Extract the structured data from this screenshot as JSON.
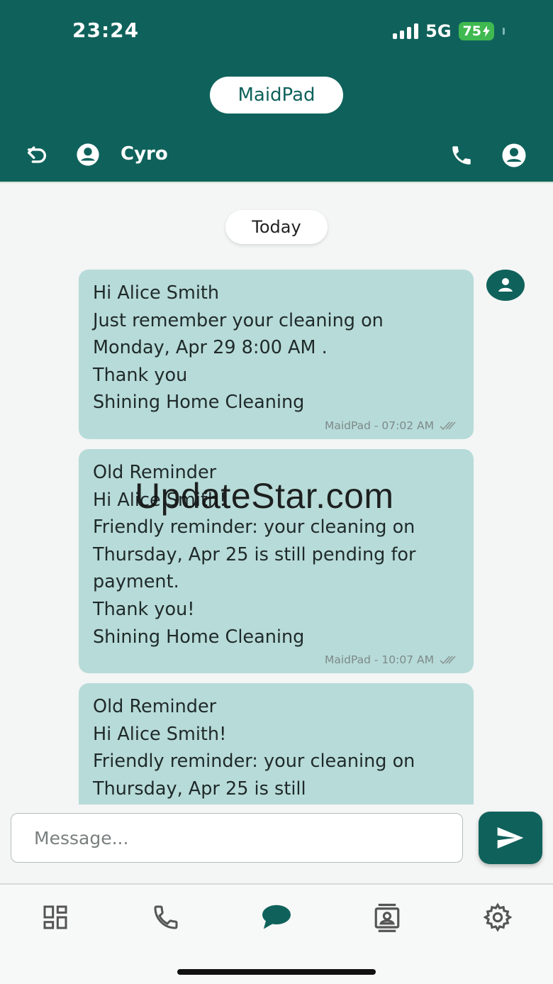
{
  "theme": {
    "brand": "#0f625b",
    "bubble": "#b7dbd8",
    "battery": "#3fb950"
  },
  "status_bar": {
    "time": "23:24",
    "network": "5G",
    "battery": "75"
  },
  "header": {
    "app_name": "MaidPad",
    "contact_name": "Cyro"
  },
  "chat": {
    "date_label": "Today",
    "messages": [
      {
        "text": "Hi Alice Smith\nJust remember your cleaning on Monday, Apr 29 8:00 AM .\nThank you\nShining Home Cleaning",
        "meta": "MaidPad - 07:02 AM"
      },
      {
        "text": "Old Reminder\nHi Alice Smith!\nFriendly reminder: your cleaning on Thursday, Apr 25 is still pending for payment.\nThank you!\nShining Home Cleaning",
        "meta": "MaidPad - 10:07 AM"
      },
      {
        "text": "Old Reminder\nHi Alice Smith!\nFriendly reminder: your cleaning on Thursday, Apr 25 is still",
        "meta": ""
      }
    ]
  },
  "composer": {
    "placeholder": "Message..."
  },
  "watermark": "UpdateStar.com",
  "bottom_nav": {
    "items": [
      "dashboard-icon",
      "phone-icon",
      "chat-icon",
      "contacts-icon",
      "settings-icon"
    ],
    "active": "chat-icon"
  }
}
